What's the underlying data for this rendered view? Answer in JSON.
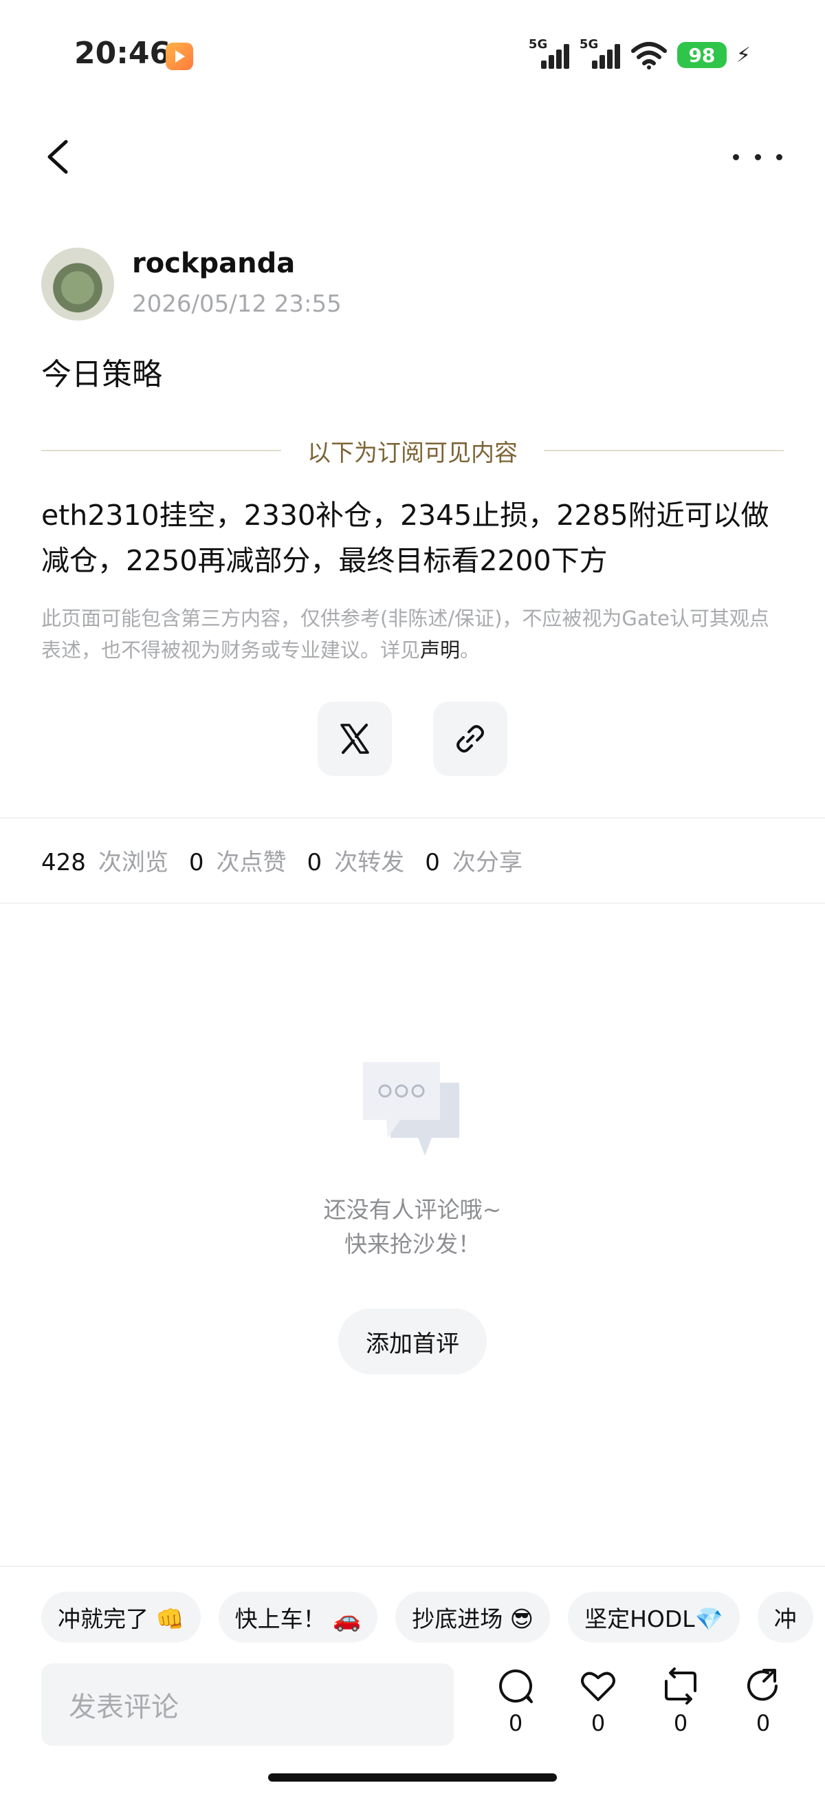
{
  "status_bar": {
    "time": "20:46",
    "signal_labels": [
      "5G",
      "5G"
    ],
    "battery": "98"
  },
  "icons": {
    "back": "chevron-left-icon",
    "more": "more-dots-icon",
    "share_x": "x-logo-icon",
    "share_link": "link-icon",
    "comment": "comment-icon",
    "like": "heart-icon",
    "repost": "repost-icon",
    "share": "share-icon"
  },
  "post": {
    "author": "rockpanda",
    "datetime": "2026/05/12 23:55",
    "title": "今日策略",
    "divider": "以下为订阅可见内容",
    "body": "eth2310挂空，2330补仓，2345止损，2285附近可以做减仓，2250再减部分，最终目标看2200下方",
    "disclaimer_text": "此页面可能包含第三方内容，仅供参考(非陈述/保证)，不应被视为Gate认可其观点表述，也不得被视为财务或专业建议。详见",
    "disclaimer_link": "声明",
    "disclaimer_end": "。"
  },
  "stats": [
    {
      "num": "428",
      "label": "次浏览"
    },
    {
      "num": "0",
      "label": "次点赞"
    },
    {
      "num": "0",
      "label": "次转发"
    },
    {
      "num": "0",
      "label": "次分享"
    }
  ],
  "empty_state": {
    "line1": "还没有人评论哦~",
    "line2": "快来抢沙发！",
    "button": "添加首评"
  },
  "quick_replies": [
    "冲就完了 👊",
    "快上车！ 🚗",
    "抄底进场 😎",
    "坚定HODL💎",
    "冲"
  ],
  "comment_bar": {
    "placeholder": "发表评论",
    "counts": [
      "0",
      "0",
      "0",
      "0"
    ]
  },
  "colors": {
    "accent_gold": "#7c6436",
    "battery_green": "#2fc54a",
    "muted_gray": "#a9abae"
  }
}
